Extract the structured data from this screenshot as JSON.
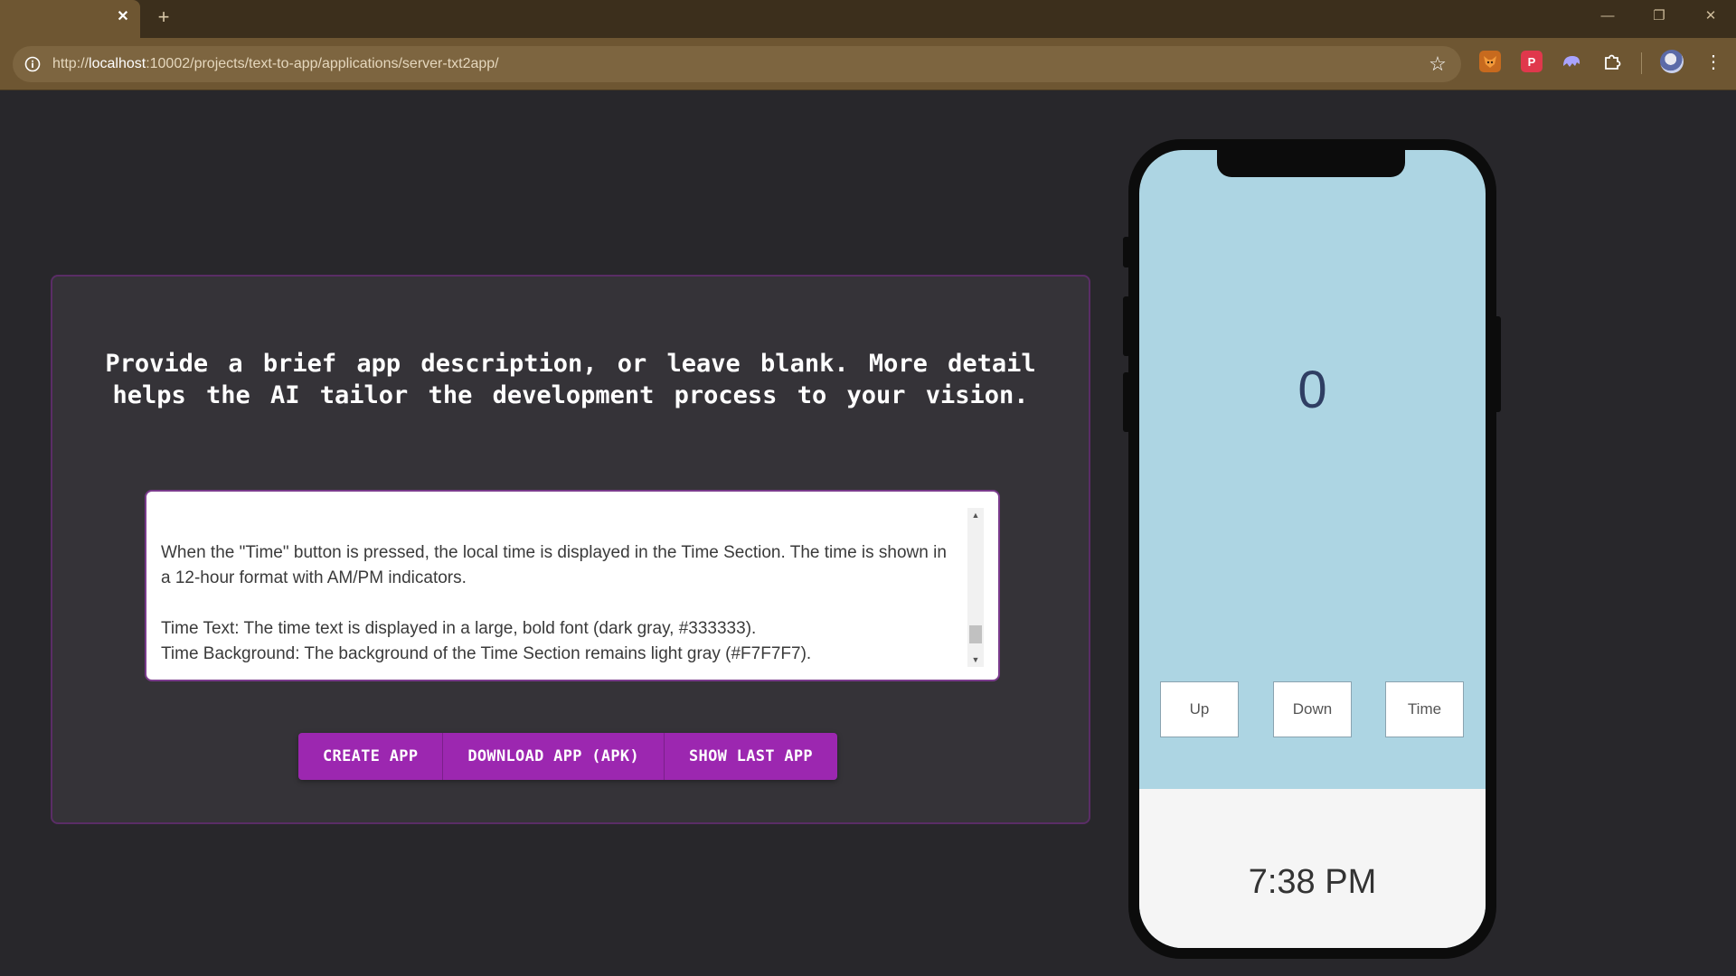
{
  "browser": {
    "url_scheme": "http://",
    "url_host": "localhost",
    "url_rest": ":10002/projects/text-to-app/applications/server-txt2app/",
    "close_glyph": "✕",
    "new_tab_glyph": "+",
    "minimize_glyph": "—",
    "restore_glyph": "❐",
    "close_window_glyph": "✕",
    "star_glyph": "☆",
    "menu_glyph": "⋮",
    "extensions": [
      "fox-extension-icon",
      "red-p-extension-icon",
      "ghost-extension-icon",
      "puzzle-extensions-icon"
    ]
  },
  "form": {
    "heading": "Provide a brief app description, or leave blank. More detail helps the AI tailor the development process to your vision.",
    "description": "When the \"Time\" button is pressed, the local time is displayed in the Time Section. The time is shown in a 12-hour format with AM/PM indicators.\n\nTime Text: The time text is displayed in a large, bold font (dark gray, #333333).\nTime Background: The background of the Time Section remains light gray (#F7F7F7).",
    "buttons": {
      "create": "CREATE APP",
      "download": "DOWNLOAD APP (APK)",
      "show_last": "SHOW LAST APP"
    },
    "accent_color": "#9c27b0"
  },
  "phone_app": {
    "counter": "0",
    "buttons": {
      "up": "Up",
      "down": "Down",
      "time": "Time"
    },
    "time": "7:38 PM",
    "background_color": "#add5e3",
    "time_section_color": "#f5f5f5"
  }
}
